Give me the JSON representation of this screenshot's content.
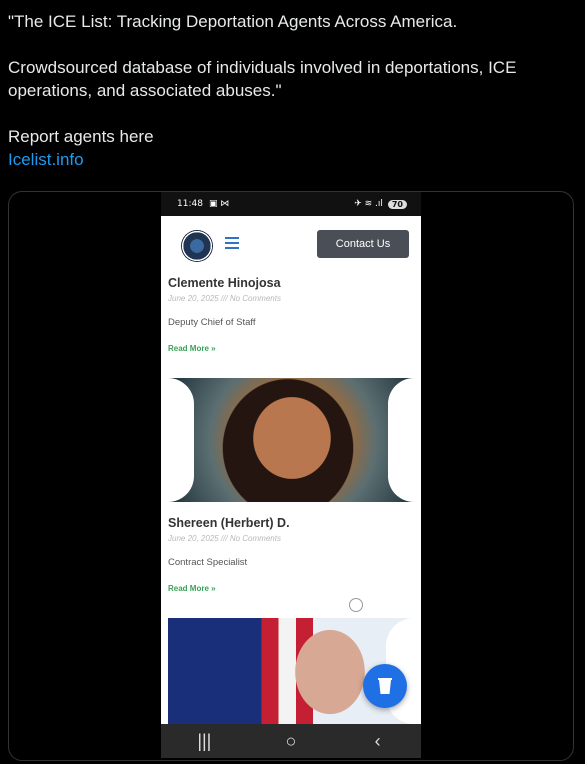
{
  "tweet": {
    "quote_line": "\"The ICE List: Tracking Deportation Agents Across America.",
    "description": "Crowdsourced database of individuals involved in deportations, ICE operations, and associated abuses.\"",
    "report_text": "Report agents here",
    "link_text": "Icelist.info"
  },
  "phone": {
    "status_time": "11:48",
    "status_left_icons": "▣ ⋈",
    "status_right_icons": "✈ ≋ .ıl",
    "battery": "70"
  },
  "site": {
    "contact_button": "Contact Us"
  },
  "posts": [
    {
      "name": "Clemente Hinojosa",
      "meta": "June 20, 2025 /// No Comments",
      "role": "Deputy Chief of Staff",
      "read_more": "Read More »"
    },
    {
      "name": "Shereen (Herbert) D.",
      "meta": "June 20, 2025 /// No Comments",
      "role": "Contract Specialist",
      "read_more": "Read More »"
    }
  ],
  "navbar": {
    "recent": "|||",
    "home": "○",
    "back": "‹"
  },
  "icons": {
    "logo": "logo-icon",
    "menu": "hamburger-menu-icon",
    "cup": "cup-icon"
  },
  "colors": {
    "link": "#1d9bf0",
    "read_more": "#3aa05a",
    "contact_button": "#4a4f57",
    "cup_button": "#1f6fe5"
  }
}
